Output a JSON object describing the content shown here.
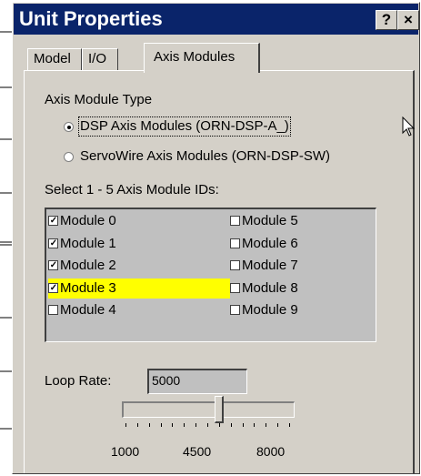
{
  "window": {
    "title": "Unit Properties",
    "help_label": "?",
    "close_label": "×"
  },
  "tabs": [
    {
      "label": "Model",
      "active": false
    },
    {
      "label": "I/O",
      "active": false
    },
    {
      "label": "Axis Modules",
      "active": true
    }
  ],
  "axis_module_type": {
    "label": "Axis Module Type",
    "options": [
      {
        "label": "DSP Axis Modules (ORN-DSP-A_)",
        "selected": true
      },
      {
        "label": "ServoWire Axis Modules (ORN-DSP-SW)",
        "selected": false
      }
    ]
  },
  "module_ids": {
    "label": "Select 1 - 5 Axis Module IDs:",
    "items": [
      {
        "label": "Module 0",
        "checked": true
      },
      {
        "label": "Module 1",
        "checked": true
      },
      {
        "label": "Module 2",
        "checked": true
      },
      {
        "label": "Module 3",
        "checked": true,
        "highlighted": true
      },
      {
        "label": "Module 4",
        "checked": false
      },
      {
        "label": "Module 5",
        "checked": false
      },
      {
        "label": "Module 6",
        "checked": false
      },
      {
        "label": "Module 7",
        "checked": false
      },
      {
        "label": "Module 8",
        "checked": false
      },
      {
        "label": "Module 9",
        "checked": false
      }
    ]
  },
  "loop_rate": {
    "label": "Loop Rate:",
    "value": "5000",
    "slider": {
      "min": 1000,
      "max": 8000,
      "value": 5000,
      "tick_count": 15
    },
    "tick_labels": [
      "1000",
      "4500",
      "8000"
    ]
  },
  "colors": {
    "title_bar": "#0a246a",
    "highlight": "#ffff00",
    "face": "#d4d0c8"
  },
  "icons": {
    "cursor": "arrow-cursor-icon",
    "help": "question-mark-icon",
    "close": "close-icon"
  }
}
